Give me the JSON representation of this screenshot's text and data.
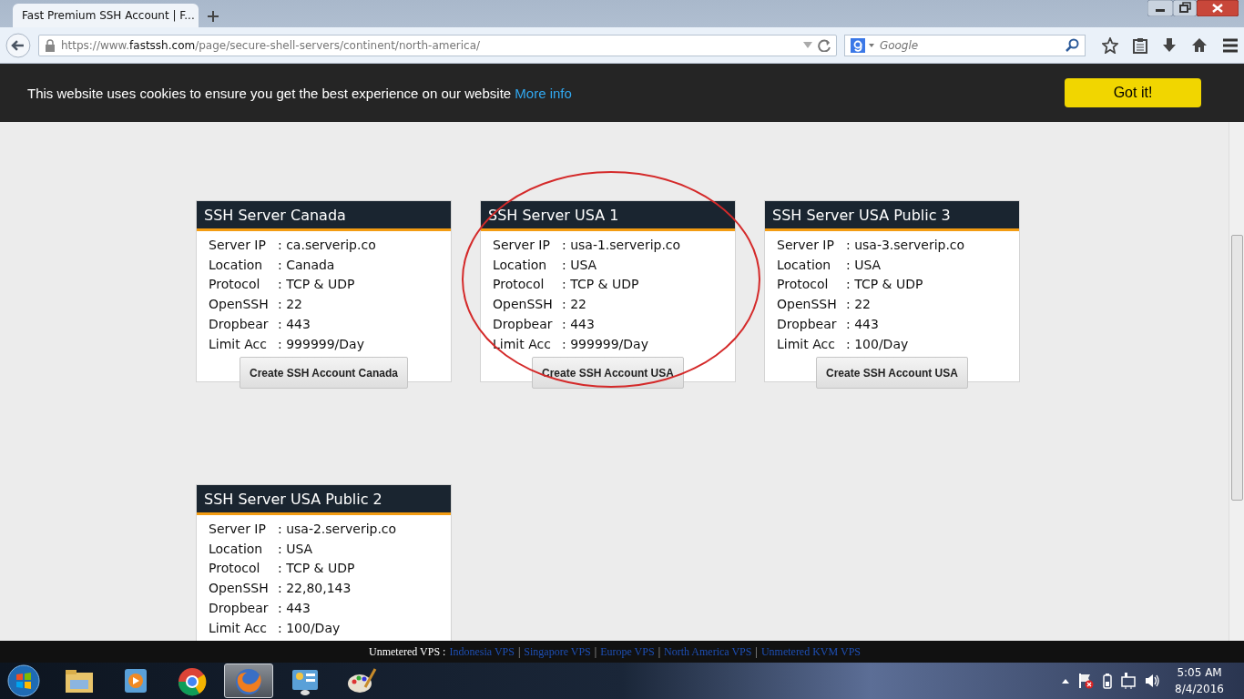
{
  "browser": {
    "tab_title": "Fast Premium SSH Account | F...",
    "url": {
      "prefix": "https://www.",
      "domain": "fastssh.com",
      "path": "/page/secure-shell-servers/continent/north-america/"
    },
    "search": {
      "placeholder": "Google"
    }
  },
  "cookie_bar": {
    "message": "This website uses cookies to ensure you get the best experience on our website",
    "link": "More info",
    "button": "Got it!"
  },
  "servers": [
    {
      "title": "SSH Server Canada",
      "highlighted": false,
      "rows": [
        {
          "label": "Server IP",
          "value": ": ca.serverip.co"
        },
        {
          "label": "Location",
          "value": ": Canada"
        },
        {
          "label": "Protocol",
          "value": ": TCP & UDP"
        },
        {
          "label": "OpenSSH",
          "value": ": 22"
        },
        {
          "label": "Dropbear",
          "value": ": 443"
        },
        {
          "label": "Limit Acc",
          "value": ": 999999/Day"
        }
      ],
      "button": "Create SSH Account Canada"
    },
    {
      "title": "SSH Server USA 1",
      "highlighted": true,
      "rows": [
        {
          "label": "Server IP",
          "value": ": usa-1.serverip.co"
        },
        {
          "label": "Location",
          "value": ": USA"
        },
        {
          "label": "Protocol",
          "value": ": TCP & UDP"
        },
        {
          "label": "OpenSSH",
          "value": ": 22"
        },
        {
          "label": "Dropbear",
          "value": ": 443"
        },
        {
          "label": "Limit Acc",
          "value": ": 999999/Day"
        }
      ],
      "button": "Create SSH Account USA"
    },
    {
      "title": "SSH Server USA Public 3",
      "highlighted": false,
      "rows": [
        {
          "label": "Server IP",
          "value": ": usa-3.serverip.co"
        },
        {
          "label": "Location",
          "value": ": USA"
        },
        {
          "label": "Protocol",
          "value": ": TCP & UDP"
        },
        {
          "label": "OpenSSH",
          "value": ": 22"
        },
        {
          "label": "Dropbear",
          "value": ": 443"
        },
        {
          "label": "Limit Acc",
          "value": ": 100/Day"
        }
      ],
      "button": "Create SSH Account USA"
    },
    {
      "title": "SSH Server USA Public 2",
      "highlighted": false,
      "rows": [
        {
          "label": "Server IP",
          "value": ": usa-2.serverip.co"
        },
        {
          "label": "Location",
          "value": ": USA"
        },
        {
          "label": "Protocol",
          "value": ": TCP & UDP"
        },
        {
          "label": "OpenSSH",
          "value": ": 22,80,143"
        },
        {
          "label": "Dropbear",
          "value": ": 443"
        },
        {
          "label": "Limit Acc",
          "value": ": 100/Day"
        }
      ]
    }
  ],
  "footer": {
    "label": "Unmetered VPS :",
    "items": [
      {
        "kind": "link",
        "text": "Indonesia VPS"
      },
      {
        "kind": "separator",
        "text": "|"
      },
      {
        "kind": "link",
        "text": "Singapore VPS"
      },
      {
        "kind": "separator",
        "text": "|"
      },
      {
        "kind": "link",
        "text": "Europe VPS"
      },
      {
        "kind": "separator",
        "text": "|"
      },
      {
        "kind": "link",
        "text": "North America VPS"
      },
      {
        "kind": "separator",
        "text": "|"
      },
      {
        "kind": "link",
        "text": "Unmetered KVM VPS"
      }
    ]
  },
  "taskbar": {
    "apps": [
      {
        "kind": "folder",
        "selected": false
      },
      {
        "kind": "media",
        "selected": false
      },
      {
        "kind": "chrome",
        "selected": false
      },
      {
        "kind": "firefox",
        "selected": true
      },
      {
        "kind": "panel",
        "selected": false
      },
      {
        "kind": "paint",
        "selected": false
      }
    ],
    "time": "5:05 AM",
    "date": "8/4/2016"
  }
}
